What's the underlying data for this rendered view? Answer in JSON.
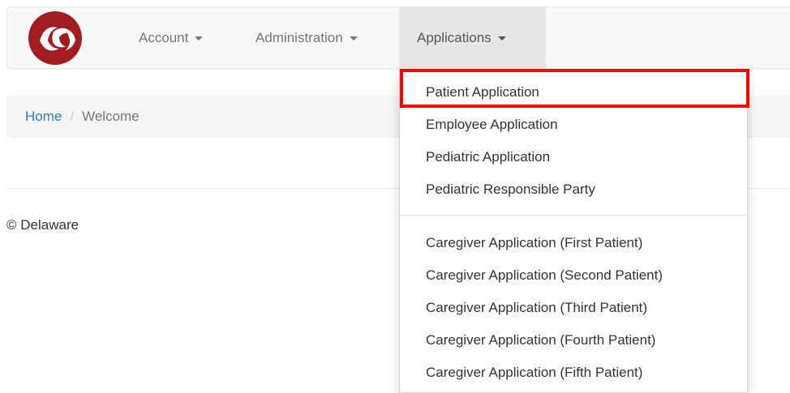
{
  "navbar": {
    "logo_name": "delaware-logo",
    "account_label": "Account",
    "administration_label": "Administration",
    "applications_label": "Applications"
  },
  "breadcrumb": {
    "home": "Home",
    "separator": "/",
    "current": "Welcome"
  },
  "footer": {
    "text": "© Delaware"
  },
  "applications_menu": {
    "items": [
      "Patient Application",
      "Employee Application",
      "Pediatric Application",
      "Pediatric Responsible Party",
      "Caregiver Application (First Patient)",
      "Caregiver Application (Second Patient)",
      "Caregiver Application (Third Patient)",
      "Caregiver Application (Fourth Patient)",
      "Caregiver Application (Fifth Patient)"
    ],
    "highlighted_item": "Patient Application",
    "highlight_color": "#ff0000"
  },
  "colors": {
    "brand": "#a01c20",
    "link": "#337ab7"
  }
}
